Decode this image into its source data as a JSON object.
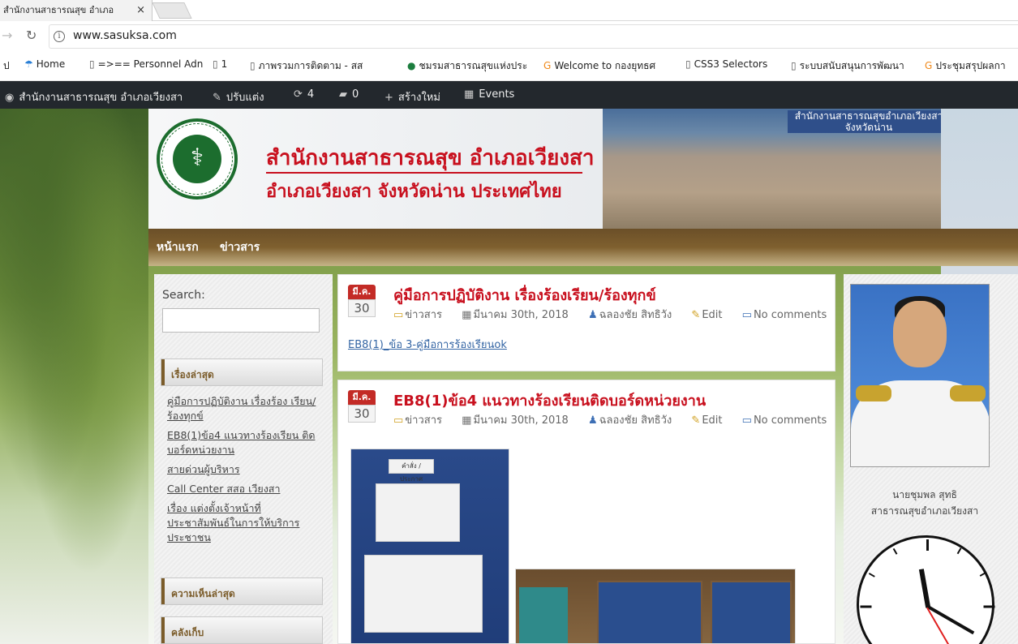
{
  "browser": {
    "tab_title": "สำนักงานสาธารณสุข อำเภอ",
    "tab_close": "×",
    "url": "www.sasuksa.com",
    "bookmarks": [
      {
        "label": "ป",
        "icon": "apps-icon"
      },
      {
        "label": "Home",
        "icon": "umbrella-icon"
      },
      {
        "label": "=>== Personnel Adn",
        "icon": "page-icon"
      },
      {
        "label": "1",
        "icon": "page-icon"
      },
      {
        "label": "ภาพรวมการติดตาม - สส",
        "icon": "page-icon"
      },
      {
        "label": "ชมรมสาธารณสุขแห่งประ",
        "icon": "green-logo-icon"
      },
      {
        "label": "Welcome to กองยุทธศ",
        "icon": "orange-g-icon"
      },
      {
        "label": "CSS3 Selectors",
        "icon": "page-icon"
      },
      {
        "label": "ระบบสนับสนุนการพัฒนา",
        "icon": "page-icon"
      },
      {
        "label": "ประชุมสรุปผลกา",
        "icon": "orange-g-icon"
      }
    ]
  },
  "adminbar": {
    "site_name": "สำนักงานสาธารณสุข อำเภอเวียงสา",
    "customize": "ปรับแต่ง",
    "updates": "4",
    "comments": "0",
    "new": "สร้างใหม่",
    "events": "Events"
  },
  "header": {
    "title_line1": "สำนักงานสาธารณสุข อำเภอเวียงสา",
    "title_line2": "อำเภอเวียงสา จังหวัดน่าน ประเทศไทย",
    "building_sign": "สำนักงานสาธารณสุขอำเภอเวียงสา จังหวัดน่าน"
  },
  "nav": {
    "items": [
      "หน้าแรก",
      "ข่าวสาร"
    ]
  },
  "sidebar_left": {
    "search_label": "Search:",
    "recent_heading": "เรื่องล่าสุด",
    "recent_posts": [
      "คู่มือการปฏิบัติงาน เรื่องร้อง เรียน/ร้องทุกข์",
      "EB8(1)ข้อ4 แนวทางร้องเรียน ติดบอร์ดหน่วยงาน",
      "สายด่วนผู้บริหาร",
      "Call Center สสอ เวียงสา",
      "เรื่อง แต่งตั้งเจ้าหน้าที่ ประชาสัมพันธ์ในการให้บริการ ประชาชน"
    ],
    "comments_heading": "ความเห็นล่าสุด",
    "archive_heading": "คลังเก็บ"
  },
  "posts": [
    {
      "month": "มี.ค.",
      "day": "30",
      "title": "คู่มือการปฏิบัติงาน เรื่องร้องเรียน/ร้องทุกข์",
      "category": "ข่าวสาร",
      "date": "มีนาคม 30th, 2018",
      "author": "ฉลองชัย สิทธิวัง",
      "edit": "Edit",
      "comments": "No comments",
      "link": "EB8(1)_ข้อ 3-คู่มือการร้องเรียนok"
    },
    {
      "month": "มี.ค.",
      "day": "30",
      "title": "EB8(1)ข้อ4 แนวทางร้องเรียนติดบอร์ดหน่วยงาน",
      "category": "ข่าวสาร",
      "date": "มีนาคม 30th, 2018",
      "author": "ฉลองชัย สิทธิวัง",
      "edit": "Edit",
      "comments": "No comments",
      "image_label": "คำสั่ง / ประกาศ"
    }
  ],
  "sidebar_right": {
    "name": "นายชุมพล สุทธิ",
    "position": "สาธารณสุขอำเภอเวียงสา"
  }
}
